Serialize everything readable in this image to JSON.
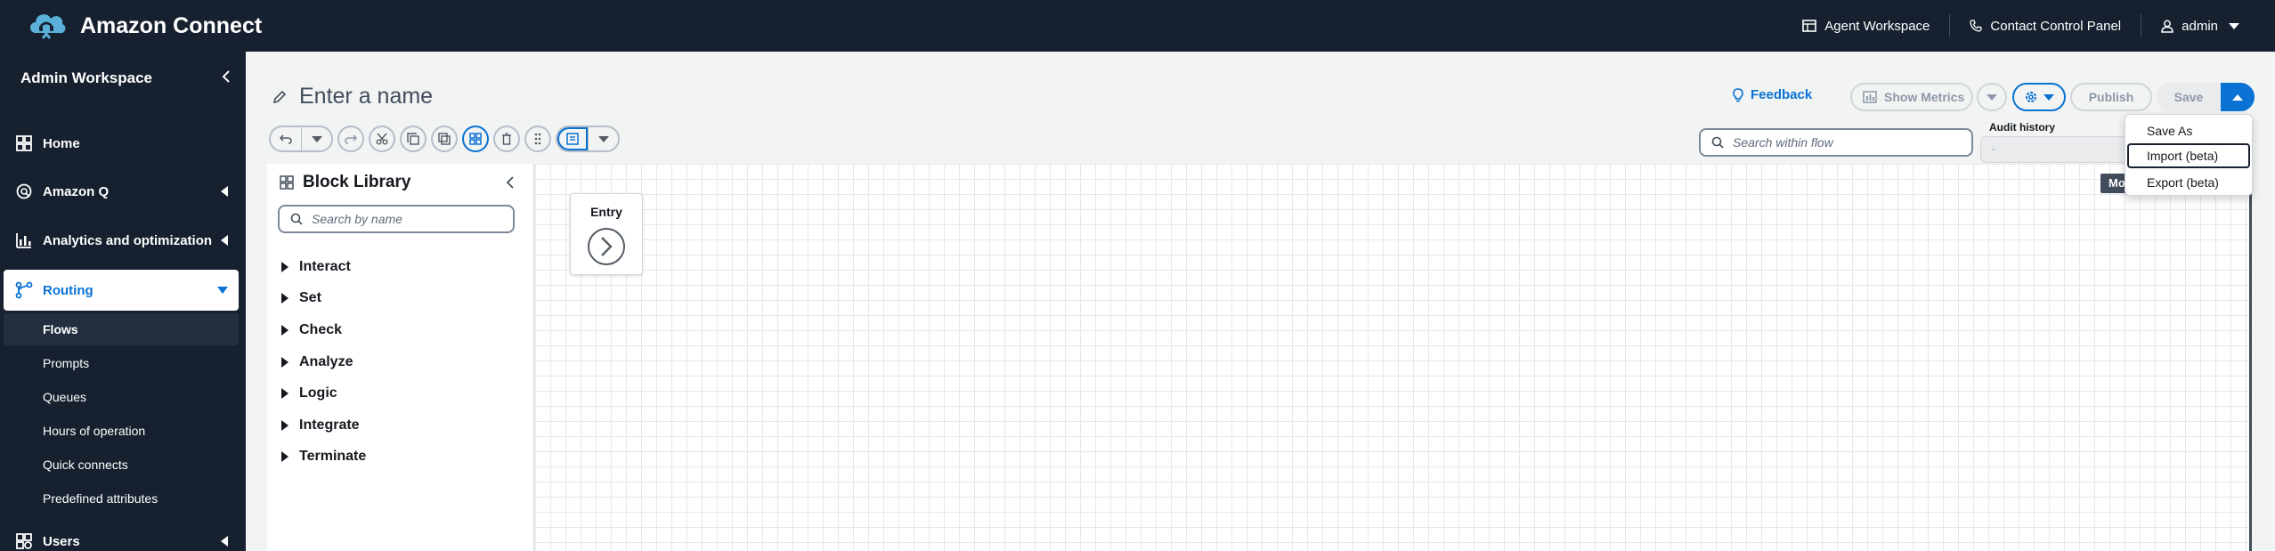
{
  "app": {
    "title": "Amazon Connect"
  },
  "top_nav": {
    "agent_workspace": "Agent Workspace",
    "contact_control_panel": "Contact Control Panel",
    "user": "admin"
  },
  "sidebar": {
    "workspace_title": "Admin Workspace",
    "items": [
      {
        "label": "Home",
        "icon": "home-grid-icon"
      },
      {
        "label": "Amazon Q",
        "icon": "amazon-q-icon"
      },
      {
        "label": "Analytics and optimization",
        "icon": "bar-chart-icon"
      },
      {
        "label": "Routing",
        "icon": "routing-icon"
      },
      {
        "label": "Users",
        "icon": "users-grid-icon"
      }
    ],
    "routing_sub": [
      "Flows",
      "Prompts",
      "Queues",
      "Hours of operation",
      "Quick connects",
      "Predefined attributes"
    ]
  },
  "editor": {
    "name_placeholder": "Enter a name",
    "feedback": "Feedback",
    "show_metrics": "Show Metrics",
    "publish": "Publish",
    "save": "Save",
    "search_flow_placeholder": "Search within flow",
    "audit_label": "Audit history",
    "audit_value": "-",
    "mo_tag": "Mo"
  },
  "save_menu": [
    "Save As",
    "Import (beta)",
    "Export (beta)"
  ],
  "library": {
    "title": "Block Library",
    "search_placeholder": "Search by name",
    "categories": [
      "Interact",
      "Set",
      "Check",
      "Analyze",
      "Logic",
      "Integrate",
      "Terminate"
    ]
  },
  "canvas": {
    "entry_label": "Entry"
  },
  "colors": {
    "nav_bg": "#16202e",
    "accent": "#0972d3"
  }
}
